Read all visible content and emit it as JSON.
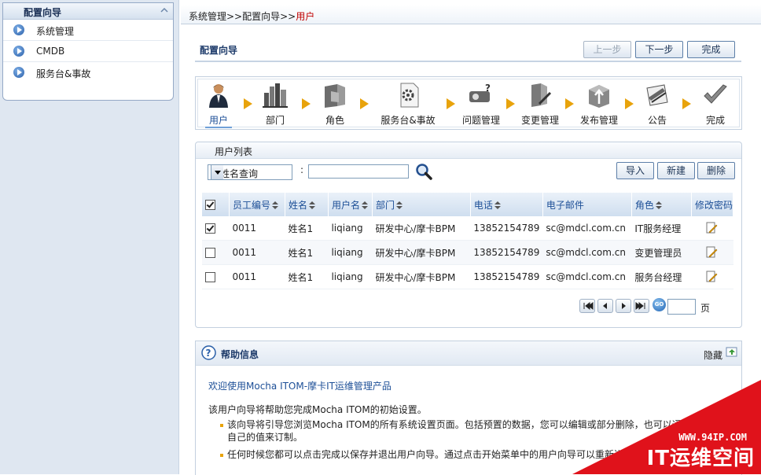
{
  "sidebar": {
    "title": "配置向导",
    "items": [
      {
        "label": "系统管理"
      },
      {
        "label": "CMDB"
      },
      {
        "label": "服务台&事故"
      }
    ]
  },
  "breadcrumb": {
    "path": "系统管理>>配置向导>>",
    "current": "用户"
  },
  "page": {
    "title": "配置向导",
    "buttons": {
      "prev": "上一步",
      "next": "下一步",
      "finish": "完成"
    }
  },
  "steps": [
    {
      "label": "用户",
      "icon": "user-icon",
      "active": true
    },
    {
      "label": "部门",
      "icon": "building-icon"
    },
    {
      "label": "角色",
      "icon": "folder-icon"
    },
    {
      "label": "服务台&事故",
      "icon": "gear-document-icon"
    },
    {
      "label": "问题管理",
      "icon": "projector-question-icon"
    },
    {
      "label": "变更管理",
      "icon": "tools-icon"
    },
    {
      "label": "发布管理",
      "icon": "upload-box-icon"
    },
    {
      "label": "公告",
      "icon": "announcement-icon"
    },
    {
      "label": "完成",
      "icon": "checkmark-icon"
    }
  ],
  "user_list": {
    "title": "用户列表",
    "query_select": "按姓名查询",
    "colon": ":",
    "search_value": "",
    "buttons": {
      "import": "导入",
      "new": "新建",
      "delete": "删除"
    },
    "columns": [
      "员工编号",
      "姓名",
      "用户名",
      "部门",
      "电话",
      "电子邮件",
      "角色",
      "修改密码"
    ],
    "rows": [
      {
        "checked": true,
        "id": "0011",
        "name": "姓名1",
        "username": "liqiang",
        "dept": "研发中心/摩卡BPM",
        "phone": "13852154789",
        "email": "sc@mdcl.com.cn",
        "role": "IT服务经理"
      },
      {
        "checked": false,
        "id": "0011",
        "name": "姓名1",
        "username": "liqiang",
        "dept": "研发中心/摩卡BPM",
        "phone": "13852154789",
        "email": "sc@mdcl.com.cn",
        "role": "变更管理员"
      },
      {
        "checked": false,
        "id": "0011",
        "name": "姓名1",
        "username": "liqiang",
        "dept": "研发中心/摩卡BPM",
        "phone": "13852154789",
        "email": "sc@mdcl.com.cn",
        "role": "服务台经理"
      }
    ],
    "pager": {
      "go": "GO",
      "page_value": "",
      "unit": "页"
    }
  },
  "help": {
    "title": "帮助信息",
    "hide_label": "隐藏",
    "welcome": "欢迎使用Mocha ITOM-摩卡IT运维管理产品",
    "desc": "该用户向导将帮助您完成Mocha ITOM的初始设置。",
    "bullets": [
      "该向导将引导您浏览Mocha ITOM的所有系统设置页面。包括预置的数据，您可以编辑或部分删除，也可以通过自己的值来订制。",
      "任何时候您都可以点击完成以保存并退出用户向导。通过点击开始菜单中的用户向导可以重新进入。"
    ]
  },
  "watermark": {
    "url": "WWW.94IP.COM",
    "text": "IT运维空间"
  },
  "colors": {
    "accent": "#1d4f97",
    "arrow": "#e8a30c",
    "watermark": "#e0121b",
    "breadcrumb_current": "#c00000"
  }
}
